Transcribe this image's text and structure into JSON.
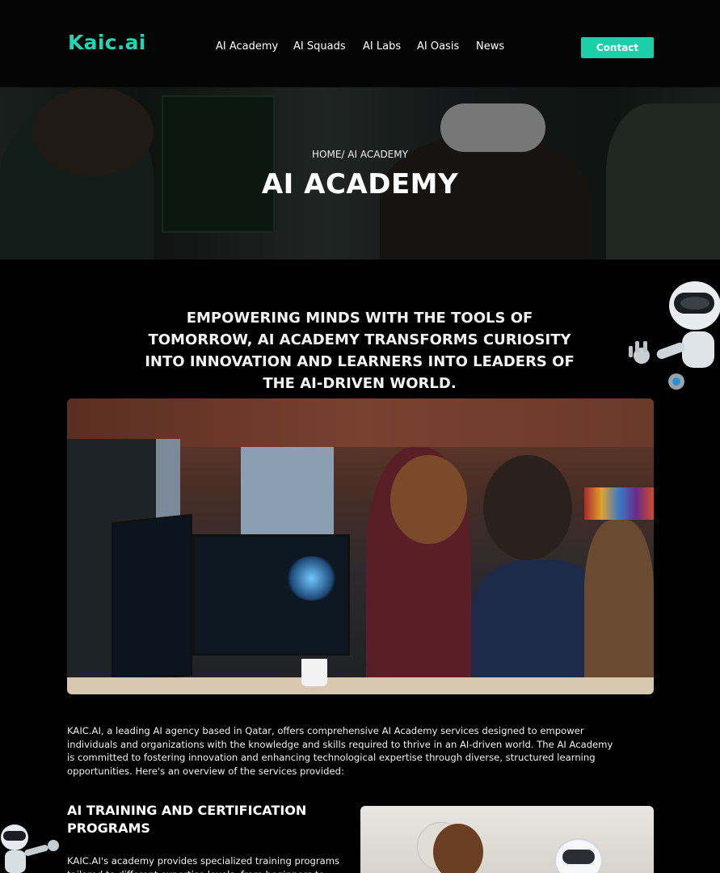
{
  "header": {
    "logo": "Kaic.ai",
    "nav": [
      "AI Academy",
      "AI Squads",
      "AI Labs",
      "AI Oasis",
      "News"
    ],
    "contact_label": "Contact"
  },
  "hero": {
    "breadcrumb": "HOME/ AI ACADEMY",
    "title": "AI ACADEMY"
  },
  "intro": {
    "tagline": "EMPOWERING MINDS WITH THE TOOLS OF TOMORROW, AI ACADEMY TRANSFORMS CURIOSITY INTO INNOVATION AND LEARNERS INTO LEADERS OF THE AI-DRIVEN WORLD.",
    "paragraph": "KAIC.AI, a leading AI agency based in Qatar, offers comprehensive AI Academy services designed to empower individuals and organizations with the knowledge and skills required to thrive in an AI-driven world. The AI Academy is committed to fostering innovation and enhancing technological expertise through diverse, structured learning opportunities. Here's an overview of the services provided:"
  },
  "section": {
    "title": "AI TRAINING AND CERTIFICATION PROGRAMS",
    "text": "KAIC.AI's academy provides specialized training programs tailored to different expertise levels, from beginners to"
  },
  "colors": {
    "accent": "#1ccfa9",
    "logo": "#21d6b4",
    "background": "#000000"
  }
}
